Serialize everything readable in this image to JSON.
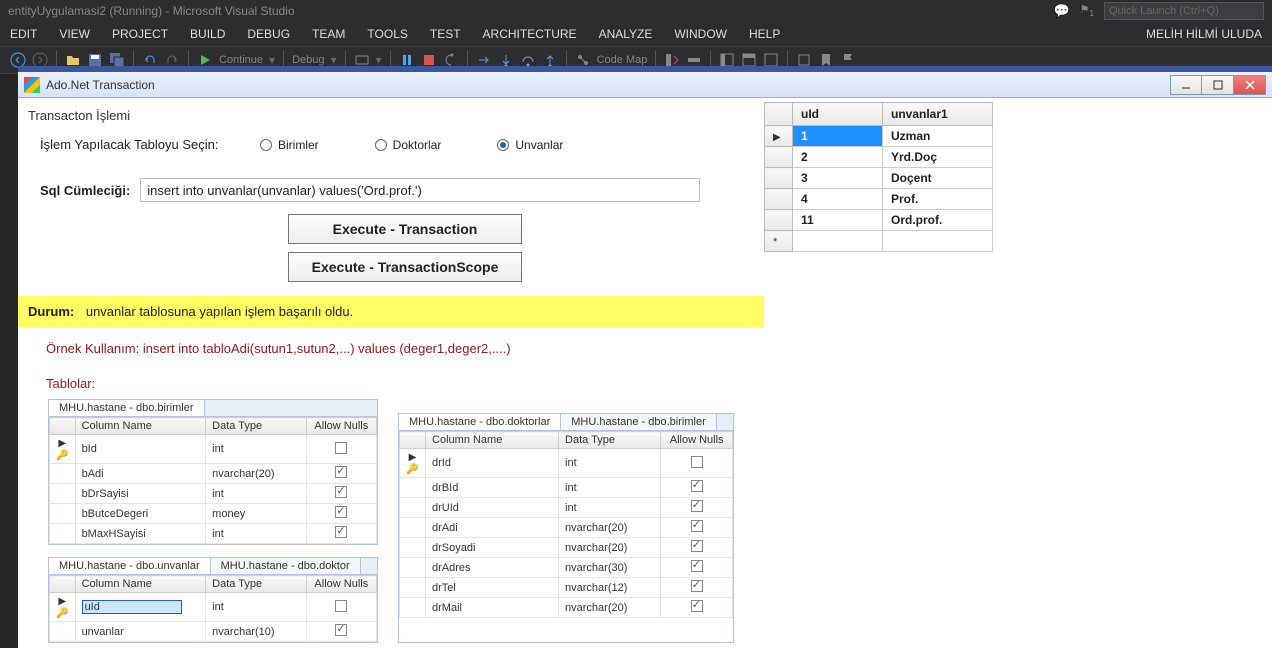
{
  "vs": {
    "title": "entityUygulamasi2 (Running) - Microsoft Visual Studio",
    "quickLaunch": "Quick Launch (Ctrl+Q)",
    "user": "MELİH HİLMİ ULUDA",
    "menu": [
      "EDIT",
      "VIEW",
      "PROJECT",
      "BUILD",
      "DEBUG",
      "TEAM",
      "TOOLS",
      "TEST",
      "ARCHITECTURE",
      "ANALYZE",
      "WINDOW",
      "HELP"
    ],
    "continue": "Continue",
    "debug": "Debug",
    "codeMap": "Code Map"
  },
  "form": {
    "title": "Ado.Net Transaction",
    "groupTitle": "Transacton İşlemi",
    "tableSelectLabel": "İşlem Yapılacak Tabloyu Seçin:",
    "radios": {
      "birimler": "Birimler",
      "doktorlar": "Doktorlar",
      "unvanlar": "Unvanlar"
    },
    "sqlLabel": "Sql Cümleciği:",
    "sqlValue": "insert into unvanlar(unvanlar) values('Ord.prof.')",
    "btnTrans": "Execute - Transaction",
    "btnScope": "Execute - TransactionScope",
    "statusLabel": "Durum:",
    "statusText": "unvanlar tablosuna yapılan işlem başarılı oldu.",
    "example": "Örnek Kullanım: insert into  tabloAdi(sutun1,sutun2,...) values (deger1,deger2,....)",
    "tablesLabel": "Tablolar:"
  },
  "schemaHeaders": {
    "col": "Column Name",
    "type": "Data Type",
    "nulls": "Allow Nulls"
  },
  "schema": {
    "birimler": {
      "tab": "MHU.hastane - dbo.birimler",
      "rows": [
        {
          "pk": true,
          "name": "bId",
          "type": "int",
          "nulls": false
        },
        {
          "pk": false,
          "name": "bAdi",
          "type": "nvarchar(20)",
          "nulls": true
        },
        {
          "pk": false,
          "name": "bDrSayisi",
          "type": "int",
          "nulls": true
        },
        {
          "pk": false,
          "name": "bButceDegeri",
          "type": "money",
          "nulls": true
        },
        {
          "pk": false,
          "name": "bMaxHSayisi",
          "type": "int",
          "nulls": true
        }
      ]
    },
    "unvanlar": {
      "tabActive": "MHU.hastane - dbo.unvanlar",
      "tabOther": "MHU.hastane - dbo.doktor",
      "rows": [
        {
          "pk": true,
          "name": "uId",
          "type": "int",
          "nulls": false,
          "editing": true
        },
        {
          "pk": false,
          "name": "unvanlar",
          "type": "nvarchar(10)",
          "nulls": true
        }
      ]
    },
    "doktorlar": {
      "tabActive": "MHU.hastane - dbo.doktorlar",
      "tabOther": "MHU.hastane - dbo.birimler",
      "rows": [
        {
          "pk": true,
          "name": "drId",
          "type": "int",
          "nulls": false
        },
        {
          "pk": false,
          "name": "drBId",
          "type": "int",
          "nulls": true
        },
        {
          "pk": false,
          "name": "drUId",
          "type": "int",
          "nulls": true
        },
        {
          "pk": false,
          "name": "drAdi",
          "type": "nvarchar(20)",
          "nulls": true
        },
        {
          "pk": false,
          "name": "drSoyadi",
          "type": "nvarchar(20)",
          "nulls": true
        },
        {
          "pk": false,
          "name": "drAdres",
          "type": "nvarchar(30)",
          "nulls": true
        },
        {
          "pk": false,
          "name": "drTel",
          "type": "nvarchar(12)",
          "nulls": true
        },
        {
          "pk": false,
          "name": "drMail",
          "type": "nvarchar(20)",
          "nulls": true
        }
      ]
    }
  },
  "dataGrid": {
    "headers": {
      "a": "uId",
      "b": "unvanlar1"
    },
    "rows": [
      {
        "id": "1",
        "val": "Uzman",
        "sel": true
      },
      {
        "id": "2",
        "val": "Yrd.Doç"
      },
      {
        "id": "3",
        "val": "Doçent"
      },
      {
        "id": "4",
        "val": "Prof."
      },
      {
        "id": "11",
        "val": "Ord.prof."
      }
    ]
  }
}
